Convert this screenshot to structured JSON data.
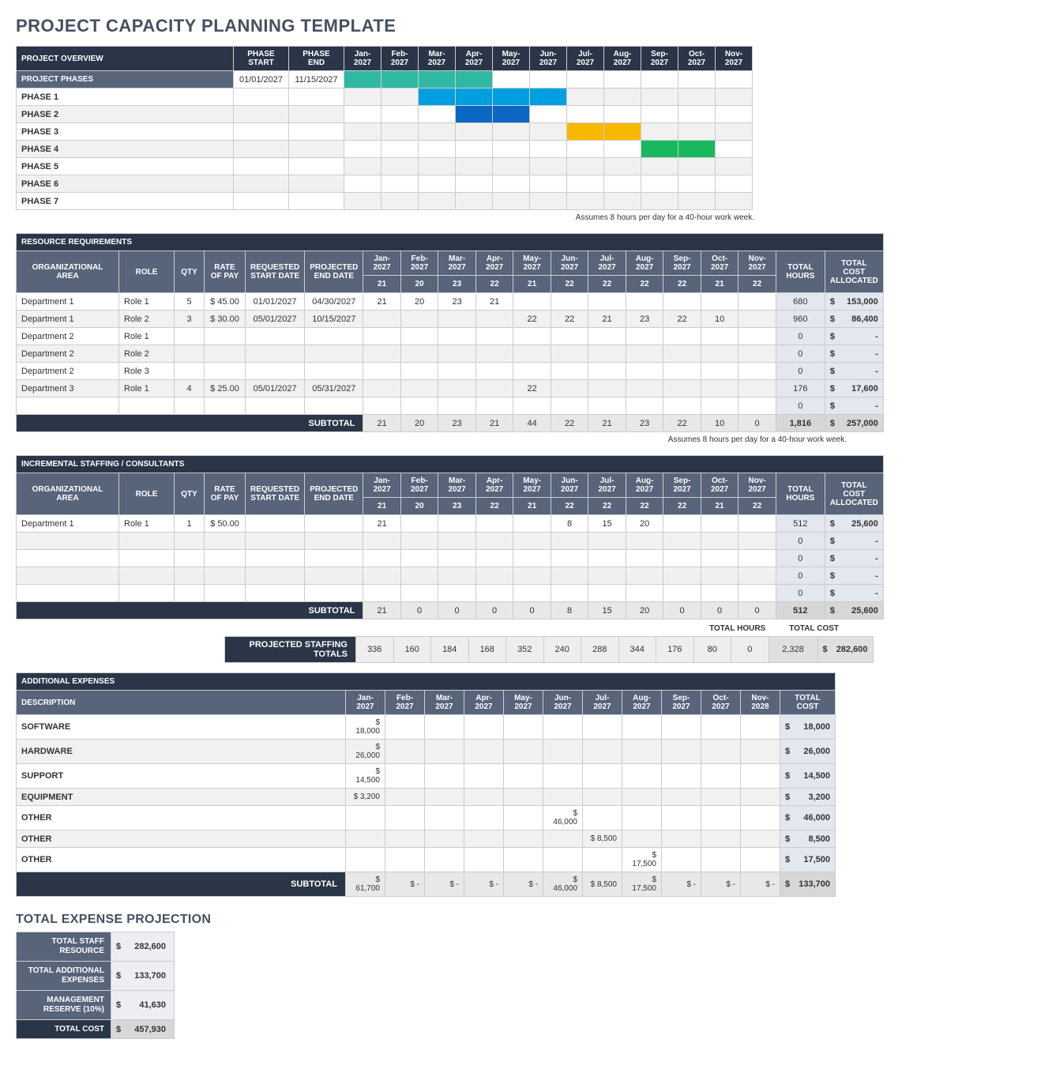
{
  "title": "PROJECT CAPACITY PLANNING TEMPLATE",
  "note": "Assumes 8 hours per day for a 40-hour work week.",
  "months": [
    "Jan-2027",
    "Feb-2027",
    "Mar-2027",
    "Apr-2027",
    "May-2027",
    "Jun-2027",
    "Jul-2027",
    "Aug-2027",
    "Sep-2027",
    "Oct-2027",
    "Nov-2027"
  ],
  "overview": {
    "header": "PROJECT OVERVIEW",
    "phase_start": "PHASE START",
    "phase_end": "PHASE END",
    "phases_header": "PROJECT PHASES",
    "phases_start": "01/01/2027",
    "phases_end": "11/15/2027",
    "rows": [
      {
        "name": "PHASE 1",
        "bars": [
          0,
          0,
          1,
          1,
          1,
          1,
          0,
          0,
          0,
          0,
          0
        ],
        "color": "blue"
      },
      {
        "name": "PHASE 2",
        "bars": [
          0,
          0,
          0,
          1,
          1,
          0,
          0,
          0,
          0,
          0,
          0
        ],
        "color": "dblue"
      },
      {
        "name": "PHASE 3",
        "bars": [
          0,
          0,
          0,
          0,
          0,
          0,
          1,
          1,
          0,
          0,
          0
        ],
        "color": "yellow"
      },
      {
        "name": "PHASE 4",
        "bars": [
          0,
          0,
          0,
          0,
          0,
          0,
          0,
          0,
          1,
          1,
          0
        ],
        "color": "green"
      },
      {
        "name": "PHASE 5",
        "bars": [
          0,
          0,
          0,
          0,
          0,
          0,
          0,
          0,
          0,
          0,
          0
        ],
        "color": ""
      },
      {
        "name": "PHASE 6",
        "bars": [
          0,
          0,
          0,
          0,
          0,
          0,
          0,
          0,
          0,
          0,
          0
        ],
        "color": ""
      },
      {
        "name": "PHASE 7",
        "bars": [
          0,
          0,
          0,
          0,
          0,
          0,
          0,
          0,
          0,
          0,
          0
        ],
        "color": ""
      }
    ],
    "teal_bars": [
      1,
      1,
      1,
      1,
      0,
      0,
      0,
      0,
      0,
      0,
      0
    ]
  },
  "resource": {
    "header": "RESOURCE REQUIREMENTS",
    "cols": {
      "org": "ORGANIZATIONAL AREA",
      "role": "ROLE",
      "qty": "QTY",
      "rate": "RATE OF PAY",
      "start": "REQUESTED START DATE",
      "end": "PROJECTED END DATE",
      "thours": "TOTAL HOURS",
      "tcost": "TOTAL COST ALLOCATED"
    },
    "month_days": [
      "21",
      "20",
      "23",
      "22",
      "21",
      "22",
      "22",
      "22",
      "22",
      "21",
      "22"
    ],
    "rows": [
      {
        "org": "Department 1",
        "role": "Role 1",
        "qty": "5",
        "rate": "$ 45.00",
        "start": "01/01/2027",
        "end": "04/30/2027",
        "months": [
          "21",
          "20",
          "23",
          "21",
          "",
          "",
          "",
          "",
          "",
          "",
          ""
        ],
        "hours": "680",
        "cost": "153,000"
      },
      {
        "org": "Department 1",
        "role": "Role 2",
        "qty": "3",
        "rate": "$ 30.00",
        "start": "05/01/2027",
        "end": "10/15/2027",
        "months": [
          "",
          "",
          "",
          "",
          "22",
          "22",
          "21",
          "23",
          "22",
          "10",
          ""
        ],
        "hours": "960",
        "cost": "86,400"
      },
      {
        "org": "Department 2",
        "role": "Role 1",
        "qty": "",
        "rate": "",
        "start": "",
        "end": "",
        "months": [
          "",
          "",
          "",
          "",
          "",
          "",
          "",
          "",
          "",
          "",
          ""
        ],
        "hours": "0",
        "cost": "-"
      },
      {
        "org": "Department 2",
        "role": "Role 2",
        "qty": "",
        "rate": "",
        "start": "",
        "end": "",
        "months": [
          "",
          "",
          "",
          "",
          "",
          "",
          "",
          "",
          "",
          "",
          ""
        ],
        "hours": "0",
        "cost": "-"
      },
      {
        "org": "Department 2",
        "role": "Role 3",
        "qty": "",
        "rate": "",
        "start": "",
        "end": "",
        "months": [
          "",
          "",
          "",
          "",
          "",
          "",
          "",
          "",
          "",
          "",
          ""
        ],
        "hours": "0",
        "cost": "-"
      },
      {
        "org": "Department 3",
        "role": "Role 1",
        "qty": "4",
        "rate": "$ 25.00",
        "start": "05/01/2027",
        "end": "05/31/2027",
        "months": [
          "",
          "",
          "",
          "",
          "22",
          "",
          "",
          "",
          "",
          "",
          ""
        ],
        "hours": "176",
        "cost": "17,600"
      },
      {
        "org": "",
        "role": "",
        "qty": "",
        "rate": "",
        "start": "",
        "end": "",
        "months": [
          "",
          "",
          "",
          "",
          "",
          "",
          "",
          "",
          "",
          "",
          ""
        ],
        "hours": "0",
        "cost": "-"
      }
    ],
    "subtotal_label": "SUBTOTAL",
    "subtotal": {
      "months": [
        "21",
        "20",
        "23",
        "21",
        "44",
        "22",
        "21",
        "23",
        "22",
        "10",
        "0"
      ],
      "hours": "1,816",
      "cost": "257,000"
    }
  },
  "incremental": {
    "header": "INCREMENTAL STAFFING / CONSULTANTS",
    "month_days": [
      "21",
      "20",
      "23",
      "22",
      "21",
      "22",
      "22",
      "22",
      "22",
      "21",
      "22"
    ],
    "rows": [
      {
        "org": "Department 1",
        "role": "Role 1",
        "qty": "1",
        "rate": "$ 50.00",
        "start": "",
        "end": "",
        "months": [
          "21",
          "",
          "",
          "",
          "",
          "8",
          "15",
          "20",
          "",
          "",
          ""
        ],
        "hours": "512",
        "cost": "25,600"
      },
      {
        "org": "",
        "role": "",
        "qty": "",
        "rate": "",
        "start": "",
        "end": "",
        "months": [
          "",
          "",
          "",
          "",
          "",
          "",
          "",
          "",
          "",
          "",
          ""
        ],
        "hours": "0",
        "cost": "-"
      },
      {
        "org": "",
        "role": "",
        "qty": "",
        "rate": "",
        "start": "",
        "end": "",
        "months": [
          "",
          "",
          "",
          "",
          "",
          "",
          "",
          "",
          "",
          "",
          ""
        ],
        "hours": "0",
        "cost": "-"
      },
      {
        "org": "",
        "role": "",
        "qty": "",
        "rate": "",
        "start": "",
        "end": "",
        "months": [
          "",
          "",
          "",
          "",
          "",
          "",
          "",
          "",
          "",
          "",
          ""
        ],
        "hours": "0",
        "cost": "-"
      },
      {
        "org": "",
        "role": "",
        "qty": "",
        "rate": "",
        "start": "",
        "end": "",
        "months": [
          "",
          "",
          "",
          "",
          "",
          "",
          "",
          "",
          "",
          "",
          ""
        ],
        "hours": "0",
        "cost": "-"
      }
    ],
    "subtotal_label": "SUBTOTAL",
    "subtotal": {
      "months": [
        "21",
        "0",
        "0",
        "0",
        "0",
        "8",
        "15",
        "20",
        "0",
        "0",
        "0"
      ],
      "hours": "512",
      "cost": "25,600"
    }
  },
  "proj_totals": {
    "label": "PROJECTED STAFFING TOTALS",
    "months": [
      "336",
      "160",
      "184",
      "168",
      "352",
      "240",
      "288",
      "344",
      "176",
      "80",
      "0"
    ],
    "hours": "2,328",
    "cost": "282,600",
    "th_label": "TOTAL HOURS",
    "tc_label": "TOTAL COST"
  },
  "expenses": {
    "header": "ADDITIONAL EXPENSES",
    "desc_label": "DESCRIPTION",
    "months": [
      "Jan-2027",
      "Feb-2027",
      "Mar-2027",
      "Apr-2027",
      "May-2027",
      "Jun-2027",
      "Jul-2027",
      "Aug-2027",
      "Sep-2027",
      "Oct-2027",
      "Nov-2028"
    ],
    "tcost": "TOTAL COST",
    "rows": [
      {
        "desc": "SOFTWARE",
        "months": [
          "$ 18,000",
          "",
          "",
          "",
          "",
          "",
          "",
          "",
          "",
          "",
          ""
        ],
        "cost": "18,000"
      },
      {
        "desc": "HARDWARE",
        "months": [
          "$ 26,000",
          "",
          "",
          "",
          "",
          "",
          "",
          "",
          "",
          "",
          ""
        ],
        "cost": "26,000"
      },
      {
        "desc": "SUPPORT",
        "months": [
          "$ 14,500",
          "",
          "",
          "",
          "",
          "",
          "",
          "",
          "",
          "",
          ""
        ],
        "cost": "14,500"
      },
      {
        "desc": "EQUIPMENT",
        "months": [
          "$   3,200",
          "",
          "",
          "",
          "",
          "",
          "",
          "",
          "",
          "",
          ""
        ],
        "cost": "3,200"
      },
      {
        "desc": "OTHER",
        "months": [
          "",
          "",
          "",
          "",
          "",
          "$ 46,000",
          "",
          "",
          "",
          "",
          ""
        ],
        "cost": "46,000"
      },
      {
        "desc": "OTHER",
        "months": [
          "",
          "",
          "",
          "",
          "",
          "",
          "$  8,500",
          "",
          "",
          "",
          ""
        ],
        "cost": "8,500"
      },
      {
        "desc": "OTHER",
        "months": [
          "",
          "",
          "",
          "",
          "",
          "",
          "",
          "$ 17,500",
          "",
          "",
          ""
        ],
        "cost": "17,500"
      }
    ],
    "subtotal_label": "SUBTOTAL",
    "subtotal": {
      "months": [
        "$ 61,700",
        "$      -",
        "$      -",
        "$      -",
        "$      -",
        "$ 46,000",
        "$  8,500",
        "$ 17,500",
        "$      -",
        "$      -",
        "$      -"
      ],
      "cost": "133,700"
    }
  },
  "summary": {
    "header": "TOTAL EXPENSE PROJECTION",
    "rows": [
      {
        "label": "TOTAL STAFF RESOURCE",
        "val": "282,600"
      },
      {
        "label": "TOTAL ADDITIONAL EXPENSES",
        "val": "133,700"
      },
      {
        "label": "MANAGEMENT RESERVE (10%)",
        "val": "41,630"
      }
    ],
    "total": {
      "label": "TOTAL COST",
      "val": "457,930"
    }
  },
  "chart_data": {
    "type": "table",
    "title": "Project Capacity Planning — Gantt, Staffing, Expenses, Totals",
    "months": [
      "Jan-2027",
      "Feb-2027",
      "Mar-2027",
      "Apr-2027",
      "May-2027",
      "Jun-2027",
      "Jul-2027",
      "Aug-2027",
      "Sep-2027",
      "Oct-2027",
      "Nov-2027"
    ],
    "gantt": [
      {
        "name": "PROJECT PHASES",
        "span": [
          1,
          4
        ]
      },
      {
        "name": "PHASE 1",
        "span": [
          3,
          6
        ]
      },
      {
        "name": "PHASE 2",
        "span": [
          4,
          5
        ]
      },
      {
        "name": "PHASE 3",
        "span": [
          7,
          8
        ]
      },
      {
        "name": "PHASE 4",
        "span": [
          9,
          10
        ]
      }
    ],
    "resource_subtotal_days": [
      21,
      20,
      23,
      21,
      44,
      22,
      21,
      23,
      22,
      10,
      0
    ],
    "resource_total_hours": 1816,
    "resource_total_cost": 257000,
    "incremental_subtotal_days": [
      21,
      0,
      0,
      0,
      0,
      8,
      15,
      20,
      0,
      0,
      0
    ],
    "incremental_total_hours": 512,
    "incremental_total_cost": 25600,
    "projected_staffing_totals": [
      336,
      160,
      184,
      168,
      352,
      240,
      288,
      344,
      176,
      80,
      0
    ],
    "projected_total_hours": 2328,
    "projected_total_cost": 282600,
    "expenses_subtotal": [
      61700,
      0,
      0,
      0,
      0,
      46000,
      8500,
      17500,
      0,
      0,
      0
    ],
    "expenses_total": 133700,
    "grand_total": 457930
  }
}
